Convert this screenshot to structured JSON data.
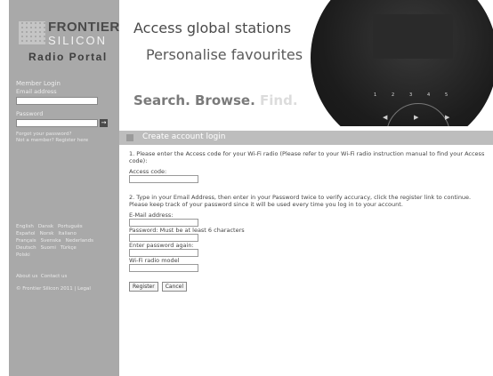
{
  "logo": {
    "line1": "FRONTIER",
    "line2": "SILICON",
    "line3": "Radio Portal"
  },
  "login": {
    "heading": "Member Login",
    "email_label": "Email address",
    "password_label": "Password",
    "go_label": "→",
    "forgot_link": "Forgot your password?",
    "register_link": "Not a member? Register here"
  },
  "languages": [
    "English",
    "Dansk",
    "Português",
    "Español",
    "Norsk",
    "Italiano",
    "Français",
    "Svenska",
    "Nederlands",
    "Deutsch",
    "Suomi",
    "Türkçe",
    "Polski"
  ],
  "footer": {
    "about": "About us",
    "contact": "Contact us",
    "copyright": "© Frontier Silicon 2011 | Legal"
  },
  "banner": {
    "line1": "Access global stations",
    "line2": "Personalise favourites",
    "line3_a": "Search. Browse.",
    "line3_b": "Find."
  },
  "device_buttons": [
    "1",
    "2",
    "3",
    "4",
    "5"
  ],
  "panel": {
    "title": "Create account login",
    "step1": "1. Please enter the Access code for your Wi-Fi radio (Please refer to your Wi-Fi radio instruction manual to find your Access code):",
    "access_code_label": "Access code:",
    "step2": "2. Type in your Email Address, then enter in your Password twice to verify accuracy, click the register link to continue.",
    "note": "Please keep track of your password since it will be used every time you log in to your account.",
    "email_label": "E-Mail address:",
    "password_label": "Password: Must be at least 6 characters",
    "password_again_label": "Enter password again:",
    "model_label": "Wi-Fi radio model",
    "register_button": "Register",
    "cancel_button": "Cancel"
  }
}
